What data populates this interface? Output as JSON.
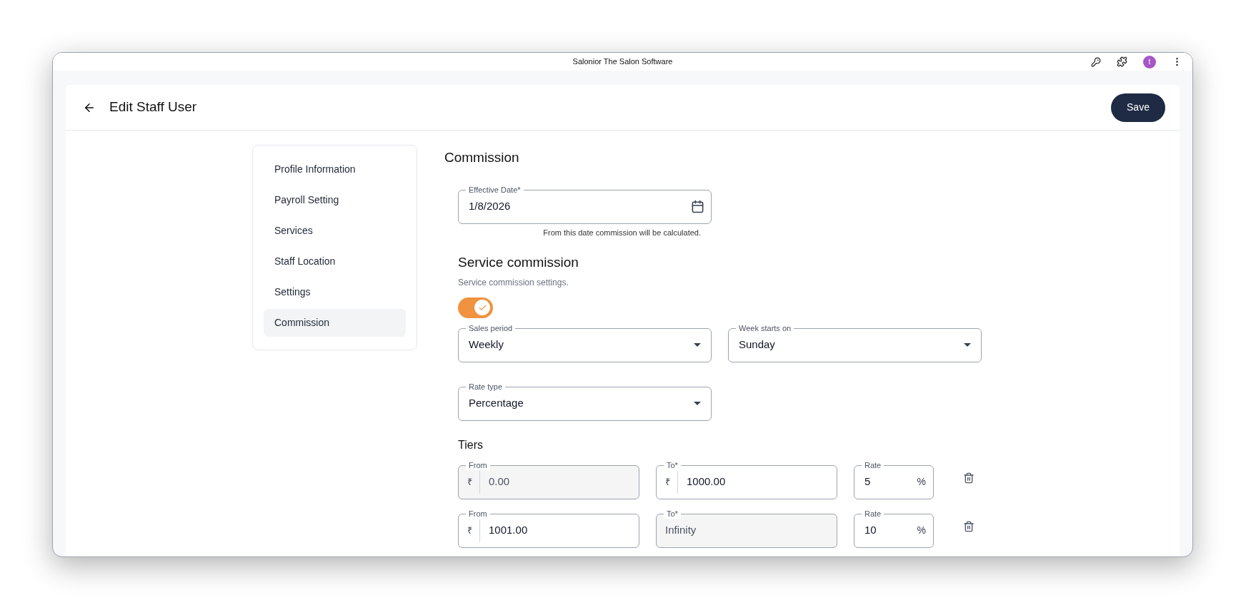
{
  "window": {
    "title": "Salonior The Salon Software",
    "avatar": "t"
  },
  "header": {
    "title": "Edit Staff User",
    "save": "Save"
  },
  "sidebar": {
    "items": [
      {
        "label": "Profile Information",
        "selected": false
      },
      {
        "label": "Payroll Setting",
        "selected": false
      },
      {
        "label": "Services",
        "selected": false
      },
      {
        "label": "Staff Location",
        "selected": false
      },
      {
        "label": "Settings",
        "selected": false
      },
      {
        "label": "Commission",
        "selected": true
      }
    ]
  },
  "commission": {
    "title": "Commission",
    "effective_date": {
      "label": "Effective Date*",
      "value": "1/8/2026",
      "helper": "From this date commission will be calculated."
    },
    "service_commission": {
      "title": "Service commission",
      "subtitle": "Service commission settings.",
      "on": true,
      "sales_period": {
        "label": "Sales period",
        "value": "Weekly"
      },
      "week_starts_on": {
        "label": "Week starts on",
        "value": "Sunday"
      },
      "rate_type": {
        "label": "Rate type",
        "value": "Percentage"
      }
    },
    "tiers": {
      "title": "Tiers",
      "rows": [
        {
          "from": {
            "label": "From",
            "prefix": "₹",
            "value": "0.00",
            "disabled": true
          },
          "to": {
            "label": "To*",
            "prefix": "₹",
            "value": "1000.00",
            "disabled": false
          },
          "rate": {
            "label": "Rate",
            "value": "5",
            "suffix": "%"
          }
        },
        {
          "from": {
            "label": "From",
            "prefix": "₹",
            "value": "1001.00",
            "disabled": false
          },
          "to": {
            "label": "To*",
            "value": "Infinity",
            "disabled": true
          },
          "rate": {
            "label": "Rate",
            "value": "10",
            "suffix": "%"
          }
        }
      ]
    }
  }
}
